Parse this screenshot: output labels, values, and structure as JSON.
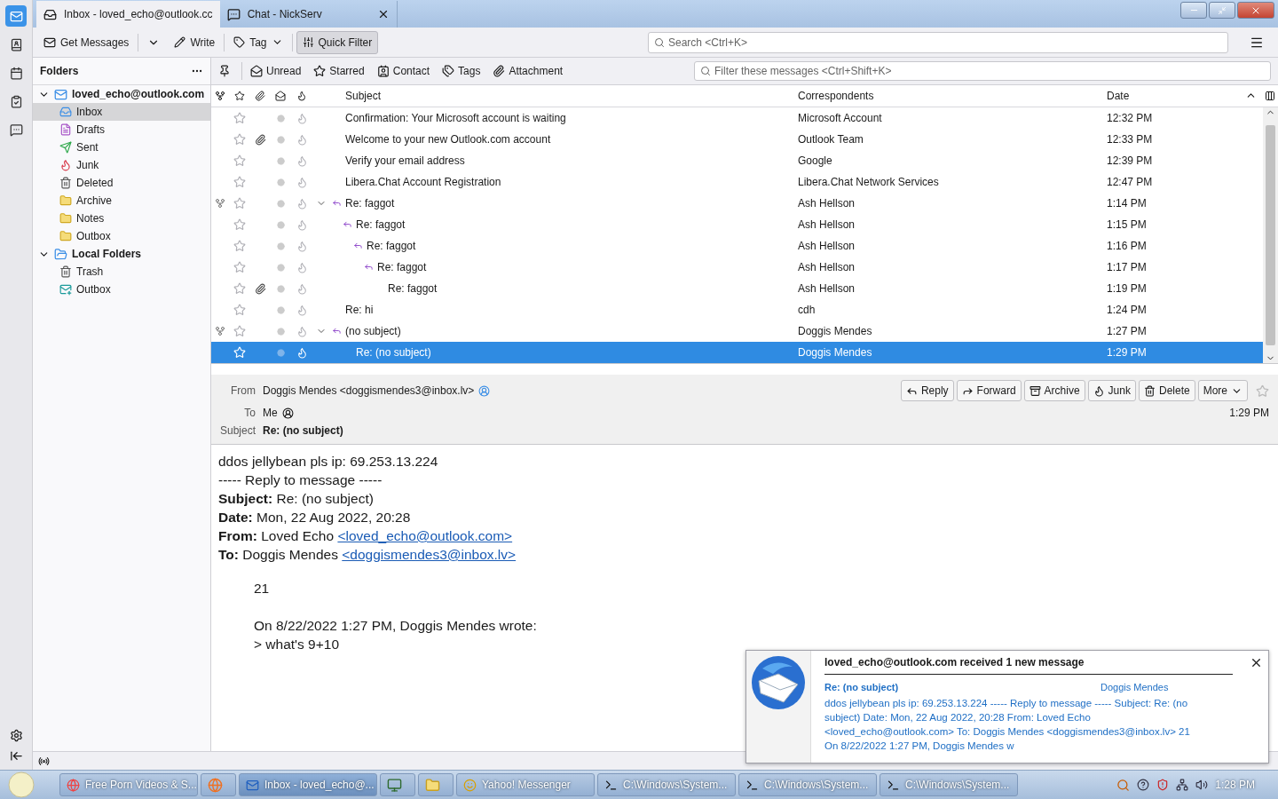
{
  "tabs": [
    {
      "label": "Inbox - loved_echo@outlook.cc",
      "kind": "mail",
      "selected": true
    },
    {
      "label": "Chat - NickServ",
      "kind": "chat",
      "selected": false
    }
  ],
  "spaces": [
    {
      "kind": "mail",
      "selected": true
    },
    {
      "kind": "contacts",
      "selected": false
    },
    {
      "kind": "calendar",
      "selected": false
    },
    {
      "kind": "tasks",
      "selected": false
    },
    {
      "kind": "chat",
      "selected": false
    }
  ],
  "toolbar": [
    {
      "label": "Get Messages",
      "kind": "get",
      "pressed": false
    },
    {
      "label": "Write",
      "kind": "write",
      "pressed": false
    },
    {
      "label": "Tag",
      "kind": "tag",
      "pressed": false
    },
    {
      "label": "Quick Filter",
      "kind": "filter",
      "pressed": true
    }
  ],
  "search": {
    "placeholder": "Search <Ctrl+K>"
  },
  "folder_pane": {
    "title": "Folders",
    "accounts": [
      {
        "name": "loved_echo@outlook.com",
        "kind": "mail",
        "expanded": true,
        "children": [
          {
            "name": "Inbox",
            "kind": "inbox",
            "selected": true
          },
          {
            "name": "Drafts",
            "kind": "drafts",
            "selected": false
          },
          {
            "name": "Sent",
            "kind": "sent",
            "selected": false
          },
          {
            "name": "Junk",
            "kind": "junk",
            "selected": false
          },
          {
            "name": "Deleted",
            "kind": "trash",
            "selected": false
          },
          {
            "name": "Archive",
            "kind": "folder",
            "selected": false
          },
          {
            "name": "Notes",
            "kind": "folder",
            "selected": false
          },
          {
            "name": "Outbox",
            "kind": "folder",
            "selected": false
          }
        ]
      },
      {
        "name": "Local Folders",
        "kind": "local",
        "expanded": true,
        "children": [
          {
            "name": "Trash",
            "kind": "trash",
            "selected": false
          },
          {
            "name": "Outbox",
            "kind": "outbox",
            "selected": false
          }
        ]
      }
    ]
  },
  "quick_filter": {
    "buttons": [
      {
        "label": "Unread",
        "kind": "unread"
      },
      {
        "label": "Starred",
        "kind": "starred"
      },
      {
        "label": "Contact",
        "kind": "contact"
      },
      {
        "label": "Tags",
        "kind": "tags"
      },
      {
        "label": "Attachment",
        "kind": "attachment"
      }
    ],
    "placeholder": "Filter these messages <Ctrl+Shift+K>"
  },
  "columns": [
    "Subject",
    "Correspondents",
    "Date"
  ],
  "messages": [
    {
      "subject": "Confirmation: Your Microsoft account is waiting",
      "correspondent": "Microsoft Account",
      "date": "12:32 PM",
      "attachment": false,
      "replied": false,
      "selected": false
    },
    {
      "subject": "Welcome to your new Outlook.com account",
      "correspondent": "Outlook Team",
      "date": "12:33 PM",
      "attachment": true,
      "replied": false,
      "selected": false
    },
    {
      "subject": "Verify your email address",
      "correspondent": "Google",
      "date": "12:39 PM",
      "attachment": false,
      "replied": false,
      "selected": false
    },
    {
      "subject": "Libera.Chat Account Registration",
      "correspondent": "Libera.Chat Network Services",
      "date": "12:47 PM",
      "attachment": false,
      "replied": false,
      "selected": false
    },
    {
      "subject": "Re: faggot",
      "correspondent": "Ash Hellson",
      "date": "1:14 PM",
      "attachment": false,
      "replied": true,
      "selected": false,
      "expanded": true,
      "children": [
        {
          "subject": "Re: faggot",
          "correspondent": "Ash Hellson",
          "date": "1:15 PM",
          "attachment": false,
          "replied": true,
          "selected": false,
          "children": [
            {
              "subject": "Re: faggot",
              "correspondent": "Ash Hellson",
              "date": "1:16 PM",
              "attachment": false,
              "replied": true,
              "selected": false,
              "children": [
                {
                  "subject": "Re: faggot",
                  "correspondent": "Ash Hellson",
                  "date": "1:17 PM",
                  "attachment": false,
                  "replied": true,
                  "selected": false,
                  "children": [
                    {
                      "subject": "Re: faggot",
                      "correspondent": "Ash Hellson",
                      "date": "1:19 PM",
                      "attachment": true,
                      "replied": false,
                      "selected": false
                    }
                  ]
                }
              ]
            }
          ]
        }
      ]
    },
    {
      "subject": "Re: hi",
      "correspondent": "cdh",
      "date": "1:24 PM",
      "attachment": false,
      "replied": false,
      "selected": false
    },
    {
      "subject": "(no subject)",
      "correspondent": "Doggis Mendes",
      "date": "1:27 PM",
      "attachment": false,
      "replied": true,
      "selected": false,
      "expanded": true,
      "children": [
        {
          "subject": "Re: (no subject)",
          "correspondent": "Doggis Mendes",
          "date": "1:29 PM",
          "attachment": false,
          "replied": false,
          "selected": true
        }
      ]
    }
  ],
  "header": {
    "from_label": "From",
    "from": "Doggis Mendes <doggismendes3@inbox.lv>",
    "to_label": "To",
    "to": "Me",
    "subject_label": "Subject",
    "subject": "Re: (no subject)",
    "date": "1:29 PM",
    "actions": [
      {
        "label": "Reply",
        "kind": "reply"
      },
      {
        "label": "Forward",
        "kind": "forward"
      },
      {
        "label": "Archive",
        "kind": "archive"
      },
      {
        "label": "Junk",
        "kind": "junk"
      },
      {
        "label": "Delete",
        "kind": "delete"
      },
      {
        "label": "More",
        "kind": "more"
      }
    ]
  },
  "body": {
    "lines": [
      {
        "kind": "text",
        "text": "ddos jellybean pls ip: 69.253.13.224"
      },
      {
        "kind": "text",
        "text": "----- Reply to message -----"
      },
      {
        "kind": "field",
        "label": "Subject:",
        "text": "Re: (no subject)"
      },
      {
        "kind": "field",
        "label": "Date:",
        "text": "Mon, 22 Aug 2022, 20:28"
      },
      {
        "kind": "field",
        "label": "From:",
        "text": "Loved Echo",
        "link": "<loved_echo@outlook.com>"
      },
      {
        "kind": "field",
        "label": "To:",
        "text": "Doggis Mendes",
        "link": "<doggismendes3@inbox.lv>"
      }
    ],
    "quoted": [
      {
        "lines": [
          "21"
        ]
      },
      {
        "lines": [
          "On 8/22/2022 1:27 PM, Doggis Mendes wrote:",
          "> what's 9+10"
        ]
      }
    ]
  },
  "notification": {
    "title": "loved_echo@outlook.com received 1 new message",
    "subject": "Re: (no subject)",
    "sender": "Doggis Mendes",
    "preview": "ddos jellybean pls ip: 69.253.13.224 ----- Reply to message ----- Subject: Re: (no subject) Date: Mon, 22 Aug 2022, 20:28 From: Loved Echo <loved_echo@outlook.com> To: Doggis Mendes <doggismendes3@inbox.lv> 21 On 8/22/2022 1:27 PM, Doggis Mendes w"
  },
  "taskbar": {
    "items": [
      {
        "label": "Free Porn Videos & S...",
        "kind": "browser",
        "selected": false
      },
      {
        "kind": "firefox",
        "selected": false
      },
      {
        "label": "Inbox - loved_echo@...",
        "kind": "mail",
        "selected": true
      },
      {
        "kind": "monitor",
        "selected": false
      },
      {
        "kind": "folder",
        "selected": false
      },
      {
        "label": "Yahoo! Messenger",
        "kind": "smiley",
        "selected": false
      },
      {
        "label": "C:\\Windows\\System...",
        "kind": "console",
        "selected": false
      },
      {
        "label": "C:\\Windows\\System...",
        "kind": "console",
        "selected": false
      },
      {
        "label": "C:\\Windows\\System...",
        "kind": "console",
        "selected": false
      }
    ],
    "time": "1:28 PM"
  }
}
